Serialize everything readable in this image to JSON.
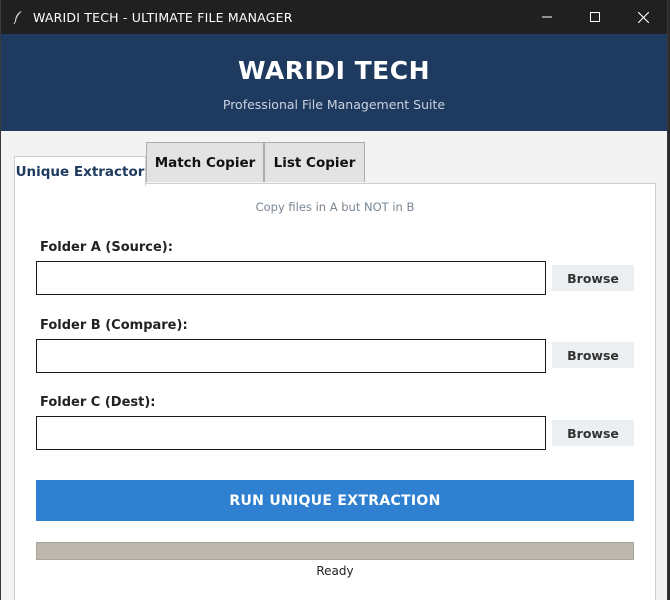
{
  "window": {
    "title": "WARIDI TECH - ULTIMATE FILE MANAGER",
    "app_icon": "feather-icon",
    "controls": [
      "minimize-icon",
      "maximize-icon",
      "close-icon"
    ]
  },
  "header": {
    "title": "WARIDI TECH",
    "subtitle": "Professional File Management Suite",
    "bg_color": "#1f3a5f"
  },
  "tabs": [
    {
      "label": "Unique Extractor",
      "active": true
    },
    {
      "label": "Match Copier",
      "active": false
    },
    {
      "label": "List Copier",
      "active": false
    }
  ],
  "panel": {
    "description": "Copy files in A but NOT in B",
    "fields": [
      {
        "label": "Folder A (Source):",
        "value": "",
        "browse_label": "Browse"
      },
      {
        "label": "Folder B (Compare):",
        "value": "",
        "browse_label": "Browse"
      },
      {
        "label": "Folder C (Dest):",
        "value": "",
        "browse_label": "Browse"
      }
    ],
    "run_label": "RUN UNIQUE EXTRACTION",
    "accent_color": "#2f80d0",
    "progress": 0,
    "status": "Ready"
  }
}
